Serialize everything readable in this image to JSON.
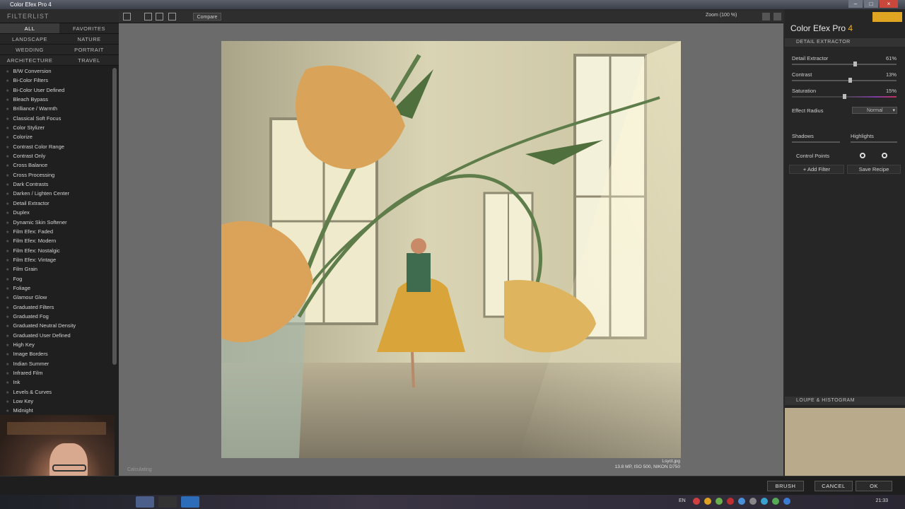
{
  "window": {
    "title": "Color Efex Pro 4"
  },
  "left_panel": {
    "header": "FILTERLIST",
    "categories": [
      "ALL",
      "FAVORITES",
      "LANDSCAPE",
      "NATURE",
      "WEDDING",
      "PORTRAIT",
      "ARCHITECTURE",
      "TRAVEL"
    ],
    "filters": [
      "B/W Conversion",
      "Bi-Color Filters",
      "Bi-Color User Defined",
      "Bleach Bypass",
      "Brilliance / Warmth",
      "Classical Soft Focus",
      "Color Stylizer",
      "Colorize",
      "Contrast Color Range",
      "Contrast Only",
      "Cross Balance",
      "Cross Processing",
      "Dark Contrasts",
      "Darken / Lighten Center",
      "Detail Extractor",
      "Duplex",
      "Dynamic Skin Softener",
      "Film Efex: Faded",
      "Film Efex: Modern",
      "Film Efex: Nostalgic",
      "Film Efex: Vintage",
      "Film Grain",
      "Fog",
      "Foliage",
      "Glamour Glow",
      "Graduated Filters",
      "Graduated Fog",
      "Graduated Neutral Density",
      "Graduated User Defined",
      "High Key",
      "Image Borders",
      "Indian Summer",
      "Infrared Film",
      "Ink",
      "Levels & Curves",
      "Low Key",
      "Midnight"
    ]
  },
  "toolbar": {
    "compare": "Compare",
    "zoom": "Zoom (100 %)"
  },
  "canvas": {
    "file_name": "Lsyct.jpg",
    "file_meta": "13.8 MP, ISO 500, NIKON D750",
    "status": "Calculating"
  },
  "right_panel": {
    "brand": "Color Efex Pro",
    "brand_version": "4",
    "filter_section": "DETAIL EXTRACTOR",
    "detail_extractor": {
      "label": "Detail Extractor",
      "value": "61%",
      "level": 0.61
    },
    "contrast": {
      "label": "Contrast",
      "value": "13%",
      "level": 0.56
    },
    "saturation": {
      "label": "Saturation",
      "value": "15%",
      "level": 0.5
    },
    "effect_radius": {
      "label": "Effect Radius",
      "value": "Normal"
    },
    "shadows": {
      "label": "Shadows"
    },
    "highlights": {
      "label": "Highlights"
    },
    "control_points": "Control Points",
    "add_filter": "+ Add Filter",
    "save_recipe": "Save Recipe",
    "loupe_section": "LOUPE & HISTOGRAM"
  },
  "bottom": {
    "brush": "BRUSH",
    "cancel": "CANCEL",
    "ok": "OK"
  },
  "taskbar": {
    "lang": "EN",
    "clock": "21:33"
  }
}
